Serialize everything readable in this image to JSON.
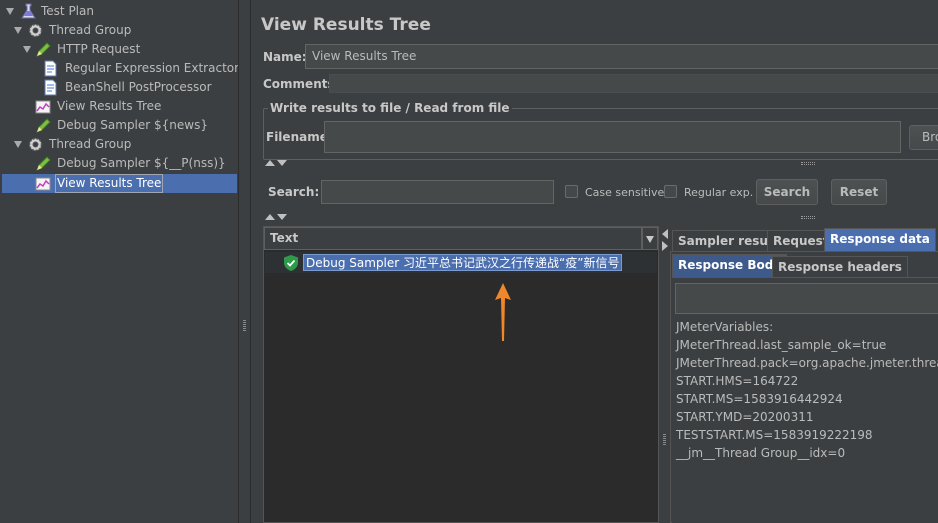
{
  "tree": {
    "items": [
      {
        "label": "Test Plan",
        "icon": "test-plan-icon"
      },
      {
        "label": "Thread Group",
        "icon": "gear-icon"
      },
      {
        "label": "HTTP Request",
        "icon": "pencil-sampler-icon"
      },
      {
        "label": "Regular Expression Extractor",
        "icon": "document-icon"
      },
      {
        "label": "BeanShell PostProcessor",
        "icon": "document-icon"
      },
      {
        "label": "View Results Tree",
        "icon": "chart-listener-icon"
      },
      {
        "label": "Debug Sampler ${news}",
        "icon": "pencil-sampler-icon"
      },
      {
        "label": "Thread Group",
        "icon": "gear-icon"
      },
      {
        "label": "Debug Sampler ${__P(nss)}",
        "icon": "pencil-sampler-icon"
      },
      {
        "label": "View Results Tree",
        "icon": "chart-listener-icon",
        "selected": true
      }
    ]
  },
  "panel": {
    "title": "View Results Tree",
    "name_label": "Name:",
    "name_value": "View Results Tree",
    "comments_label": "Comments:",
    "file_legend": "Write results to file / Read from file",
    "filename_label": "Filename",
    "browse_label": "Bro"
  },
  "search": {
    "label": "Search:",
    "value": "",
    "case_sensitive": "Case sensitive",
    "regular_exp": "Regular exp.",
    "search_button": "Search",
    "reset_button": "Reset"
  },
  "results": {
    "column_header": "Text",
    "rows": [
      {
        "label": "Debug Sampler 习近平总书记武汉之行传递战“疫”新信号",
        "status": "success"
      }
    ]
  },
  "detail": {
    "tabs": [
      "Sampler result",
      "Request",
      "Response data"
    ],
    "active_tab": "Response data",
    "subtabs": [
      "Response Body",
      "Response headers"
    ],
    "active_subtab": "Response Body",
    "lines": [
      "JMeterVariables:",
      "JMeterThread.last_sample_ok=true",
      "JMeterThread.pack=org.apache.jmeter.threads.S",
      "START.HMS=164722",
      "START.MS=1583916442924",
      "START.YMD=20200311",
      "TESTSTART.MS=1583919222198",
      "__jm__Thread Group__idx=0"
    ]
  },
  "colors": {
    "background": "#3c3f41",
    "dark_panel": "#2b2b2b",
    "selection": "#4b6eaf",
    "annotation_arrow": "#f0872b",
    "success_shield": "#2e9b4a"
  }
}
